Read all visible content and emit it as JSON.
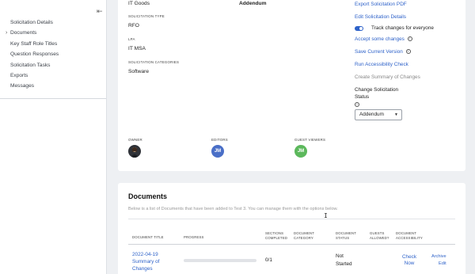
{
  "sidebar": {
    "collapse_icon": "collapse-left-icon",
    "items": [
      {
        "label": "Solicitation Details"
      },
      {
        "label": "Documents"
      },
      {
        "label": "Key Staff Role Titles"
      },
      {
        "label": "Question Responses"
      },
      {
        "label": "Solicitation Tasks"
      },
      {
        "label": "Exports"
      },
      {
        "label": "Messages"
      }
    ]
  },
  "details": {
    "category_value": "IT Goods",
    "status_value": "Addendum",
    "solicitation_type_label": "Solicitation Type",
    "solicitation_type_value": "RFO",
    "lpa_label": "LPA",
    "lpa_value": "IT MSA",
    "categories_label": "Solicitation Categories",
    "categories_value": "Software"
  },
  "actions": {
    "export_pdf": "Export Solicitation PDF",
    "edit_details": "Edit Solicitation Details",
    "track_changes": "Track changes for everyone",
    "track_changes_on": true,
    "accept_changes": "Accept some changes",
    "save_version": "Save Current Version",
    "accessibility_check": "Run Accessibility Check",
    "summary_changes": "Create Summary of Changes",
    "change_status_label": "Change Solicitation Status",
    "status_select": "Addendum"
  },
  "people": {
    "owner_label": "Owner",
    "editors_label": "Editors",
    "guest_label": "Guest Viewers",
    "editor_initials": "JM",
    "guest_initials": "JM",
    "editor_color": "#4a6fc7",
    "guest_color": "#5cb85c"
  },
  "documents": {
    "title": "Documents",
    "description": "Below is a list of Documents that have been added to Test 3. You can manage them with the options below.",
    "columns": {
      "title": "Document Title",
      "progress": "Progress",
      "sections": "Sections Completed",
      "category": "Document Category",
      "status": "Document Status",
      "guests": "Guests Allowed?",
      "accessibility": "Document Accessibility"
    },
    "rows": [
      {
        "title": "2022-04-19 Summary of Changes",
        "progress": 0,
        "sections": "0/1",
        "category": "",
        "status": "Not Started",
        "guests": "",
        "accessibility": "Check Now",
        "actions": [
          "Archive",
          "Edit"
        ]
      }
    ]
  },
  "colors": {
    "accent": "#2e62c9",
    "background": "#eef0f3"
  }
}
